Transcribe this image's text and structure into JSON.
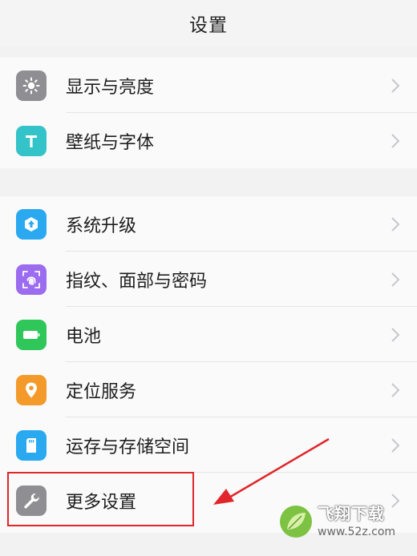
{
  "header": {
    "title": "设置"
  },
  "group1": [
    {
      "label": "显示与亮度",
      "icon": "brightness-icon",
      "color": "#8e8e93"
    },
    {
      "label": "壁纸与字体",
      "icon": "font-icon",
      "color": "#34c3c8"
    }
  ],
  "group2": [
    {
      "label": "系统升级",
      "icon": "system-update-icon",
      "color": "#2aa9f0"
    },
    {
      "label": "指纹、面部与密码",
      "icon": "fingerprint-icon",
      "color": "#9b6bf0"
    },
    {
      "label": "电池",
      "icon": "battery-icon",
      "color": "#2fc65a"
    },
    {
      "label": "定位服务",
      "icon": "location-icon",
      "color": "#f39a2b"
    },
    {
      "label": "运存与存储空间",
      "icon": "storage-icon",
      "color": "#2aa9f0"
    },
    {
      "label": "更多设置",
      "icon": "wrench-icon",
      "color": "#8e8e93"
    }
  ],
  "annotation": {
    "highlight_color": "#e0262b"
  },
  "watermark": {
    "name": "飞翔下载",
    "url": "www.52z.com"
  }
}
